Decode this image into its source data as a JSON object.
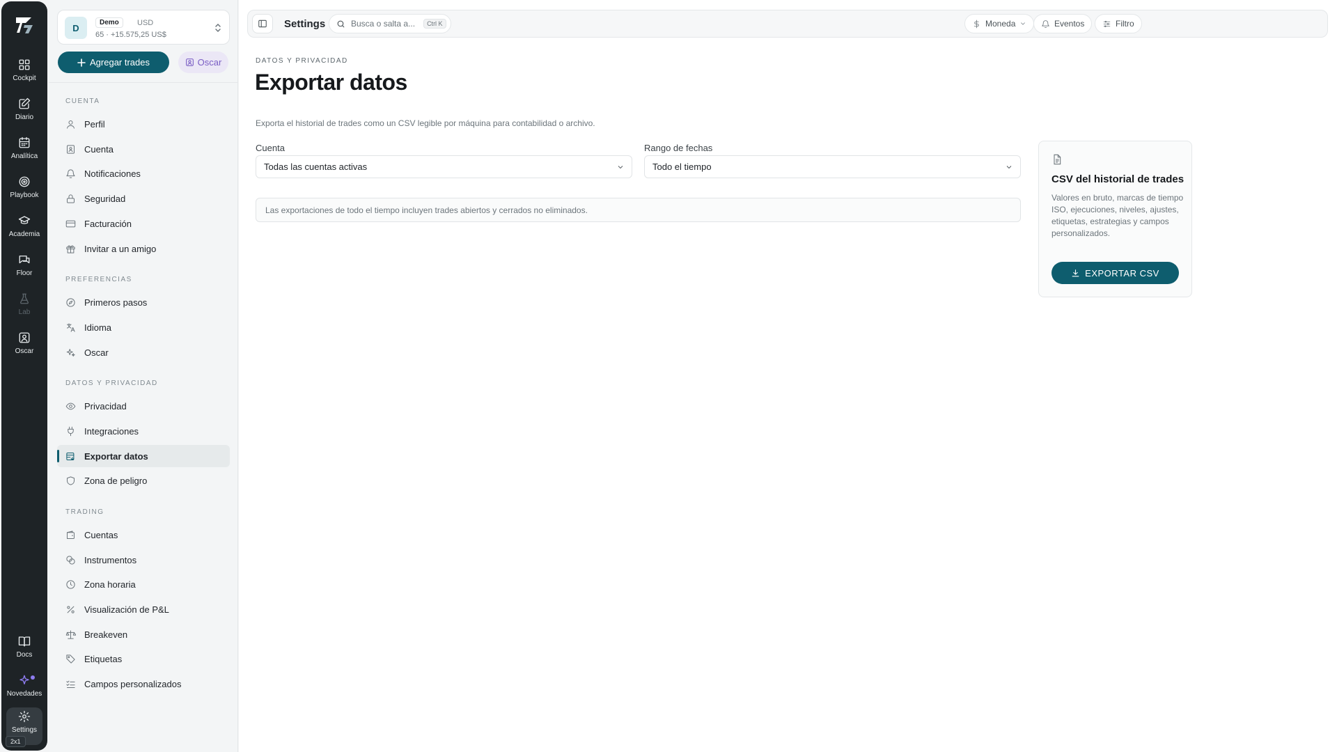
{
  "rail": {
    "items": [
      {
        "label": "Cockpit",
        "icon": "grid-icon"
      },
      {
        "label": "Diario",
        "icon": "edit-icon"
      },
      {
        "label": "Analítica",
        "icon": "calendar-icon"
      },
      {
        "label": "Playbook",
        "icon": "target-icon"
      },
      {
        "label": "Academia",
        "icon": "graduation-cap-icon"
      },
      {
        "label": "Floor",
        "icon": "chat-icon"
      },
      {
        "label": "Lab",
        "icon": "flask-icon"
      },
      {
        "label": "Oscar",
        "icon": "user-square-icon"
      }
    ],
    "bottom": [
      {
        "label": "Docs",
        "icon": "book-icon"
      },
      {
        "label": "Novedades",
        "icon": "sparkle-icon"
      },
      {
        "label": "Settings",
        "icon": "gear-icon"
      }
    ],
    "badge": "2x1"
  },
  "account": {
    "avatar": "D",
    "name": "Demo",
    "currency": "USD",
    "summary": "65 · +15.575,25 US$"
  },
  "sidebar": {
    "add_trades": "Agregar trades",
    "oscar": "Oscar",
    "sections": {
      "cuenta": "CUENTA",
      "preferencias": "PREFERENCIAS",
      "datos": "DATOS Y PRIVACIDAD",
      "trading": "TRADING"
    },
    "items": {
      "perfil": "Perfil",
      "cuenta": "Cuenta",
      "notificaciones": "Notificaciones",
      "seguridad": "Seguridad",
      "facturacion": "Facturación",
      "invitar": "Invitar a un amigo",
      "primeros_pasos": "Primeros pasos",
      "idioma": "Idioma",
      "oscar": "Oscar",
      "privacidad": "Privacidad",
      "integraciones": "Integraciones",
      "exportar": "Exportar datos",
      "peligro": "Zona de peligro",
      "cuentas": "Cuentas",
      "instrumentos": "Instrumentos",
      "zona_horaria": "Zona horaria",
      "pnl": "Visualización de P&L",
      "breakeven": "Breakeven",
      "etiquetas": "Etiquetas",
      "campos": "Campos personalizados"
    }
  },
  "topbar": {
    "title": "Settings",
    "search_placeholder": "Busca o salta a...",
    "search_shortcut": "Ctrl K",
    "moneda": "Moneda",
    "eventos": "Eventos",
    "filtro": "Filtro"
  },
  "page": {
    "eyebrow": "DATOS Y PRIVACIDAD",
    "title": "Exportar datos",
    "description": "Exporta el historial de trades como un CSV legible por máquina para contabilidad o archivo.",
    "account_label": "Cuenta",
    "account_value": "Todas las cuentas activas",
    "range_label": "Rango de fechas",
    "range_value": "Todo el tiempo",
    "note": "Las exportaciones de todo el tiempo incluyen trades abiertos y cerrados no eliminados."
  },
  "card": {
    "title": "CSV del historial de trades",
    "description": "Valores en bruto, marcas de tiempo ISO, ejecuciones, niveles, ajustes, etiquetas, estrategias y campos personalizados.",
    "button": "EXPORTAR CSV"
  },
  "colors": {
    "accent": "#0e5d6e",
    "rail_bg": "#1e2326",
    "purple": "#8e7cf0"
  }
}
